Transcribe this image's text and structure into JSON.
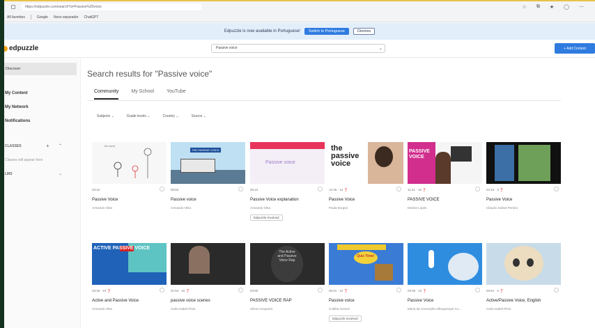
{
  "browser": {
    "url": "https://edpuzzle.com/search?q=Passive%20voice",
    "bookmarks": [
      "All favorites",
      "Google",
      "Novo separador",
      "ChatGPT"
    ]
  },
  "banner": {
    "text": "Edpuzzle is now available in Portuguese!",
    "primary": "Switch to Portuguese",
    "secondary": "Dismiss"
  },
  "header": {
    "logo": "edpuzzle",
    "search_value": "Passive voice",
    "add_button": "+ Add Content"
  },
  "sidebar": {
    "discover": "Discover",
    "my_content": "My Content",
    "my_network": "My Network",
    "notifications": "Notifications",
    "classes": "CLASSES",
    "classes_empty": "Classes will appear here",
    "lms": "LMS"
  },
  "main": {
    "title": "Search results for \"Passive voice\"",
    "tabs": [
      "Community",
      "My School",
      "YouTube"
    ],
    "filters": [
      "Subjects",
      "Grade levels",
      "Country",
      "Source"
    ]
  },
  "cards": [
    {
      "duration": "03:34",
      "questions": "",
      "title": "Passive Voice",
      "author": "Armando Olea",
      "tag": "",
      "thumb_caption": "the wind"
    },
    {
      "duration": "08:50",
      "questions": "",
      "title": "Passive voice",
      "author": "Armando Olea",
      "tag": "",
      "thumb_caption": "THE PASSIVE VOICE"
    },
    {
      "duration": "05:10",
      "questions": "",
      "title": "Passive Voice explanation",
      "author": "Armando Olea",
      "tag": "Edpuzzle Involved",
      "thumb_caption": "Passive voice"
    },
    {
      "duration": "12:46",
      "questions": "14",
      "title": "Passive Voice",
      "author": "Paula Borges",
      "tag": "",
      "thumb_caption": "the passive voice"
    },
    {
      "duration": "11:21",
      "questions": "15",
      "title": "PASSIVE VOICE",
      "author": "Denise Lopes",
      "tag": "",
      "thumb_caption": "PASSIVE VOICE"
    },
    {
      "duration": "04:10",
      "questions": "3",
      "title": "Passive Voice",
      "author": "Cláudio Sobral Pereira",
      "tag": "",
      "thumb_caption": ""
    },
    {
      "duration": "03:36",
      "questions": "10",
      "title": "Active and Passive Voice",
      "author": "Armando Olea",
      "tag": "",
      "thumb_caption": "ACTIVE PASSIVE VOICE"
    },
    {
      "duration": "01:53",
      "questions": "10",
      "title": "passive voice scenes",
      "author": "Carla Isabel Pinto",
      "tag": "",
      "thumb_caption": ""
    },
    {
      "duration": "03:50",
      "questions": "",
      "title": "PASSIVE VOICE RAP",
      "author": "Sílvia Cerqueira",
      "tag": "",
      "thumb_caption": "The Active and Passive Voice Rap"
    },
    {
      "duration": "05:21",
      "questions": "12",
      "title": "Passive voice",
      "author": "Cubiba Gomes",
      "tag": "Edpuzzle Involved",
      "thumb_caption": "Quiz Time!"
    },
    {
      "duration": "03:06",
      "questions": "10",
      "title": "Passive Voice",
      "author": "Maria da Conceição Albuquerque Co...",
      "tag": "",
      "thumb_caption": ""
    },
    {
      "duration": "03:51",
      "questions": "4",
      "title": "Active/Passive Voice, English",
      "author": "Carla Isabel Pinto",
      "tag": "",
      "thumb_caption": ""
    }
  ],
  "colors": {
    "accent": "#2f7be0",
    "logo": "#f2a413",
    "banner_bg": "#e3eefb"
  }
}
